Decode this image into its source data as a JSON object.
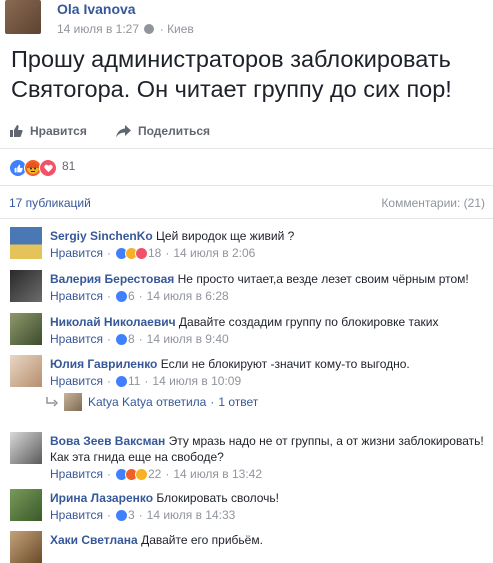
{
  "post": {
    "author": "Ola Ivanova",
    "time": "14 июля в 1:27",
    "location": "Киев",
    "text": "Прошу администраторов заблокировать Святогора. Он читает группу до сих пор!"
  },
  "actions": {
    "like": "Нравится",
    "share": "Поделиться"
  },
  "reactions": {
    "count": "81",
    "types": [
      "like-icon",
      "angry-icon",
      "love-icon"
    ]
  },
  "counts": {
    "publications": "17 публикаций",
    "comments": "Комментарии: (21)"
  },
  "comments": [
    {
      "name": "Sergiy SinchenKo",
      "text": "Цей виродок ще живий ?",
      "like": "Нравится",
      "likes": "18",
      "time": "14 июля в 2:06"
    },
    {
      "name": "Валерия Берестовая",
      "text": "Не просто читает,а везде лезет своим чёрным ртом!",
      "like": "Нравится",
      "likes": "6",
      "time": "14 июля в 6:28"
    },
    {
      "name": "Николай Николаевич",
      "text": "Давайте создадим группу по блокировке таких",
      "like": "Нравится",
      "likes": "8",
      "time": "14 июля в 9:40"
    },
    {
      "name": "Юлия Гавриленко",
      "text": "Если не блокируют -значит кому-то выгодно.",
      "like": "Нравится",
      "likes": "11",
      "time": "14 июля в 10:09"
    },
    {
      "name": "Вова Зеев Ваксман",
      "text": "Эту мразь надо не от группы, а от жизни заблокировать! Как эта гнида еще на свободе?",
      "like": "Нравится",
      "likes": "22",
      "time": "14 июля в 13:42"
    },
    {
      "name": "Ирина Лазаренко",
      "text": "Блокировать сволочь!",
      "like": "Нравится",
      "likes": "3",
      "time": "14 июля в 14:33"
    },
    {
      "name": "Хаки Светлана",
      "text": "Давайте его прибьём."
    }
  ],
  "reply": {
    "author": "Katya Katya",
    "verb": "ответила",
    "count": "1 ответ"
  }
}
